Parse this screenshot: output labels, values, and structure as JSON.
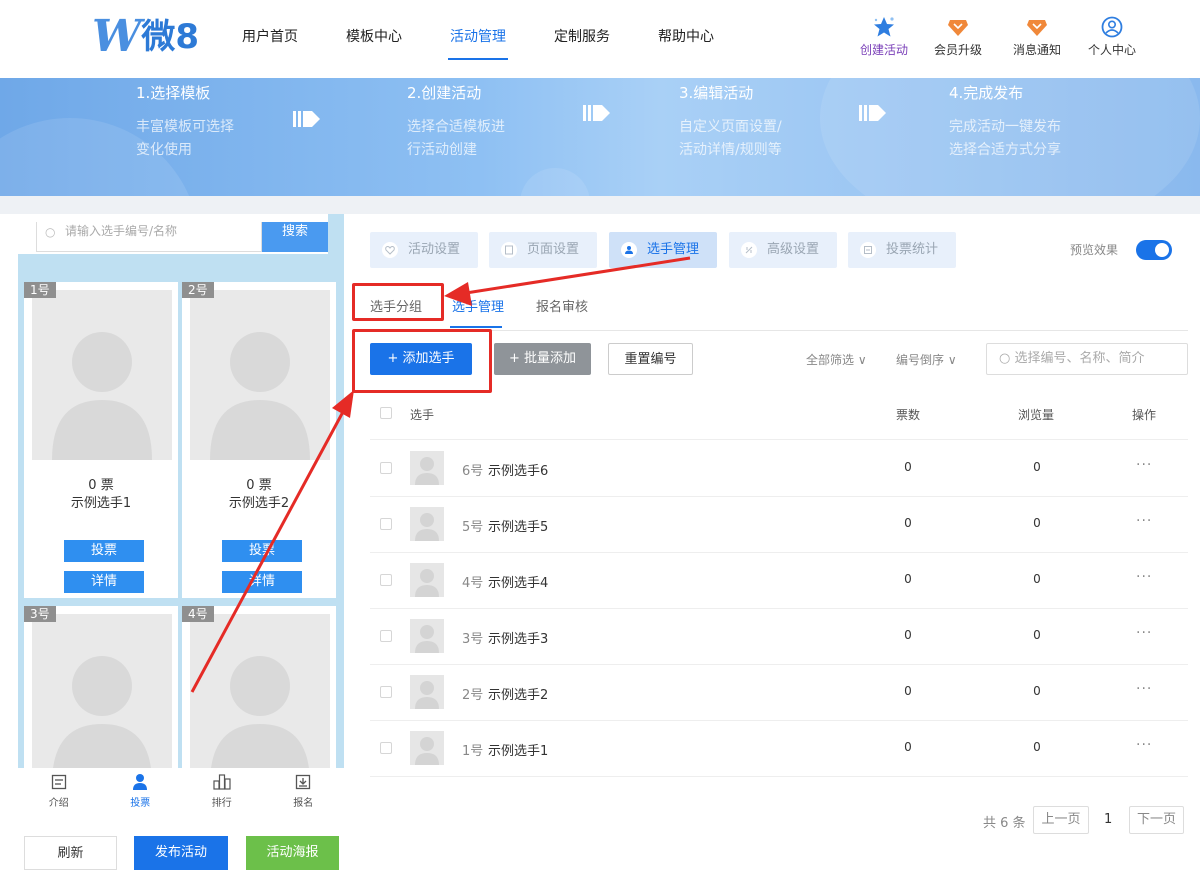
{
  "logo": {
    "letter": "W",
    "text": "微8"
  },
  "nav": {
    "items": [
      "用户首页",
      "模板中心",
      "活动管理",
      "定制服务",
      "帮助中心"
    ],
    "active_index": 2
  },
  "top_actions": [
    {
      "label": "创建活动",
      "icon": "star-icon"
    },
    {
      "label": "会员升级",
      "icon": "crown-icon"
    },
    {
      "label": "消息通知",
      "icon": "bell-icon"
    },
    {
      "label": "个人中心",
      "icon": "user-icon"
    }
  ],
  "steps": [
    {
      "title": "1.选择模板",
      "line1": "丰富模板可选择",
      "line2": "变化使用"
    },
    {
      "title": "2.创建活动",
      "line1": "选择合适模板进",
      "line2": "行活动创建"
    },
    {
      "title": "3.编辑活动",
      "line1": "自定义页面设置/",
      "line2": "活动详情/规则等"
    },
    {
      "title": "4.完成发布",
      "line1": "完成活动一键发布",
      "line2": "选择合适方式分享"
    }
  ],
  "preview": {
    "search_placeholder": "请输入选手编号/名称",
    "search_button": "搜索",
    "cards": [
      {
        "badge": "1号",
        "votes": "0 票",
        "name": "示例选手1",
        "vote_btn": "投票",
        "detail_btn": "详情"
      },
      {
        "badge": "2号",
        "votes": "0 票",
        "name": "示例选手2",
        "vote_btn": "投票",
        "detail_btn": "详情"
      },
      {
        "badge": "3号"
      },
      {
        "badge": "4号"
      }
    ],
    "bottom_nav": [
      {
        "label": "介绍",
        "icon": "intro-icon"
      },
      {
        "label": "投票",
        "icon": "person-icon"
      },
      {
        "label": "排行",
        "icon": "ranking-icon"
      },
      {
        "label": "报名",
        "icon": "signup-icon"
      }
    ],
    "bottom_nav_active": 1
  },
  "left_buttons": {
    "refresh": "刷新",
    "publish": "发布活动",
    "poster": "活动海报"
  },
  "tabs": [
    "活动设置",
    "页面设置",
    "选手管理",
    "高级设置",
    "投票统计"
  ],
  "active_tab": 2,
  "preview_toggle": {
    "label": "预览效果",
    "on": true
  },
  "subtabs": [
    "选手分组",
    "选手管理",
    "报名审核"
  ],
  "active_subtab": 1,
  "toolbar": {
    "add": "+ 添加选手",
    "batch_add": "+ 批量添加",
    "renumber": "重置编号",
    "filter_all": "全部筛选",
    "sort": "编号倒序",
    "search_placeholder": "选择编号、名称、简介"
  },
  "table": {
    "headers": {
      "player": "选手",
      "votes": "票数",
      "views": "浏览量",
      "actions": "操作"
    },
    "rows": [
      {
        "num": "6号",
        "name": "示例选手6",
        "votes": "0",
        "views": "0",
        "actions": "···"
      },
      {
        "num": "5号",
        "name": "示例选手5",
        "votes": "0",
        "views": "0",
        "actions": "···"
      },
      {
        "num": "4号",
        "name": "示例选手4",
        "votes": "0",
        "views": "0",
        "actions": "···"
      },
      {
        "num": "3号",
        "name": "示例选手3",
        "votes": "0",
        "views": "0",
        "actions": "···"
      },
      {
        "num": "2号",
        "name": "示例选手2",
        "votes": "0",
        "views": "0",
        "actions": "···"
      },
      {
        "num": "1号",
        "name": "示例选手1",
        "votes": "0",
        "views": "0",
        "actions": "···"
      }
    ]
  },
  "pager": {
    "total": "共 6 条",
    "prev": "上一页",
    "page": "1",
    "next": "下一页"
  },
  "colors": {
    "primary": "#1a73e8",
    "blue_button": "#2f8ff0",
    "green_button": "#6cc04a",
    "highlight_red": "#e52b26"
  }
}
